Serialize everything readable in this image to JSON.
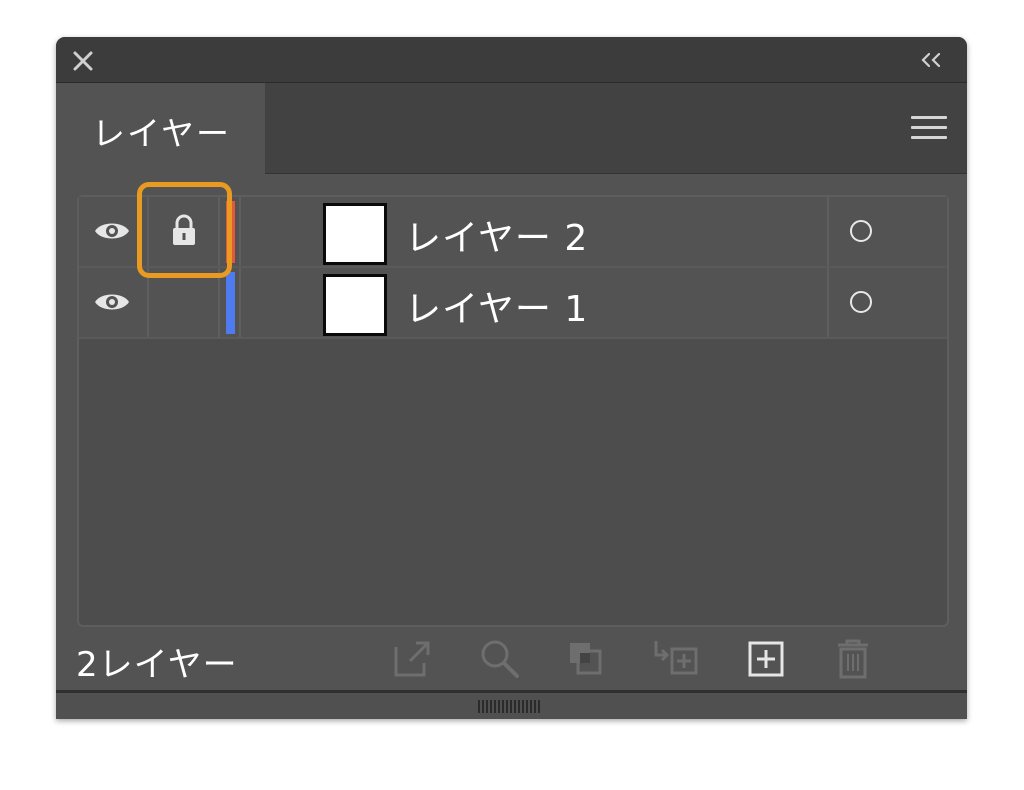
{
  "panel": {
    "tab_label": "レイヤー",
    "footer_count": "2レイヤー"
  },
  "layers": [
    {
      "name": "レイヤー 2",
      "visible": true,
      "locked": true,
      "color": "#e05a3a"
    },
    {
      "name": "レイヤー 1",
      "visible": true,
      "locked": false,
      "color": "#4f7bf0"
    }
  ],
  "icons": {
    "close": "close-icon",
    "collapse": "double-chevron-left-icon",
    "menu": "hamburger-menu-icon",
    "visibility": "eye-icon",
    "lock": "lock-icon",
    "target": "target-circle-icon",
    "export": "export-icon",
    "search": "search-icon",
    "clipping": "clipping-mask-icon",
    "new_sublayer": "new-sublayer-icon",
    "new_layer": "new-layer-icon",
    "delete": "trash-icon"
  },
  "colors": {
    "highlight": "#e89a21",
    "panel_bg": "#535353"
  }
}
